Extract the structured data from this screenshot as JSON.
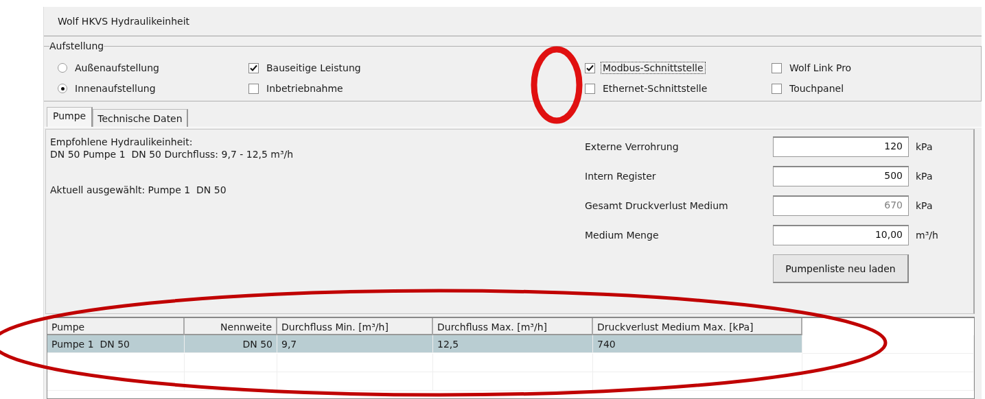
{
  "window": {
    "title": "Wolf HKVS Hydraulikeinheit"
  },
  "aufstellung": {
    "title": "Aufstellung",
    "options": [
      {
        "kind": "radio",
        "label": "Außenaufstellung",
        "selected": false,
        "focused": false
      },
      {
        "kind": "checkbox",
        "label": "Bauseitige Leistung",
        "checked": true,
        "focused": false
      },
      {
        "kind": "checkbox",
        "label": "Modbus-Schnittstelle",
        "checked": true,
        "focused": true
      },
      {
        "kind": "checkbox",
        "label": "Wolf Link Pro",
        "checked": false,
        "focused": false
      },
      {
        "kind": "radio",
        "label": "Innenaufstellung",
        "selected": true,
        "focused": false
      },
      {
        "kind": "checkbox",
        "label": "Inbetriebnahme",
        "checked": false,
        "focused": false
      },
      {
        "kind": "checkbox",
        "label": "Ethernet-Schnittstelle",
        "checked": false,
        "focused": false
      },
      {
        "kind": "checkbox",
        "label": "Touchpanel",
        "checked": false,
        "focused": false
      }
    ]
  },
  "tabs": [
    {
      "label": "Pumpe",
      "selected": true
    },
    {
      "label": "Technische Daten",
      "selected": false
    }
  ],
  "pump_panel": {
    "recommendation": [
      "Empfohlene Hydraulikeinheit:",
      "DN 50 Pumpe 1  DN 50 Durchfluss: 9,7 - 12,5 m³/h"
    ],
    "current_selection": "Aktuell ausgewählt: Pumpe 1  DN 50",
    "fields": [
      {
        "label": "Externe Verrohrung",
        "value": "120",
        "unit": "kPa",
        "disabled": false
      },
      {
        "label": "Intern Register",
        "value": "500",
        "unit": "kPa",
        "disabled": false
      },
      {
        "label": "Gesamt Druckverlust Medium",
        "value": "670",
        "unit": "kPa",
        "disabled": true
      },
      {
        "label": "Medium Menge",
        "value": "10,00",
        "unit": "m³/h",
        "disabled": false
      }
    ],
    "button": "Pumpenliste neu laden"
  },
  "table": {
    "columns": [
      "Pumpe",
      "Nennweite",
      "Durchfluss Min. [m³/h]",
      "Durchfluss Max. [m³/h]",
      "Druckverlust Medium Max. [kPa]"
    ],
    "rows": [
      {
        "cells": [
          "Pumpe 1  DN 50",
          "DN 50",
          "9,7",
          "12,5",
          "740"
        ],
        "selected": true
      }
    ]
  }
}
